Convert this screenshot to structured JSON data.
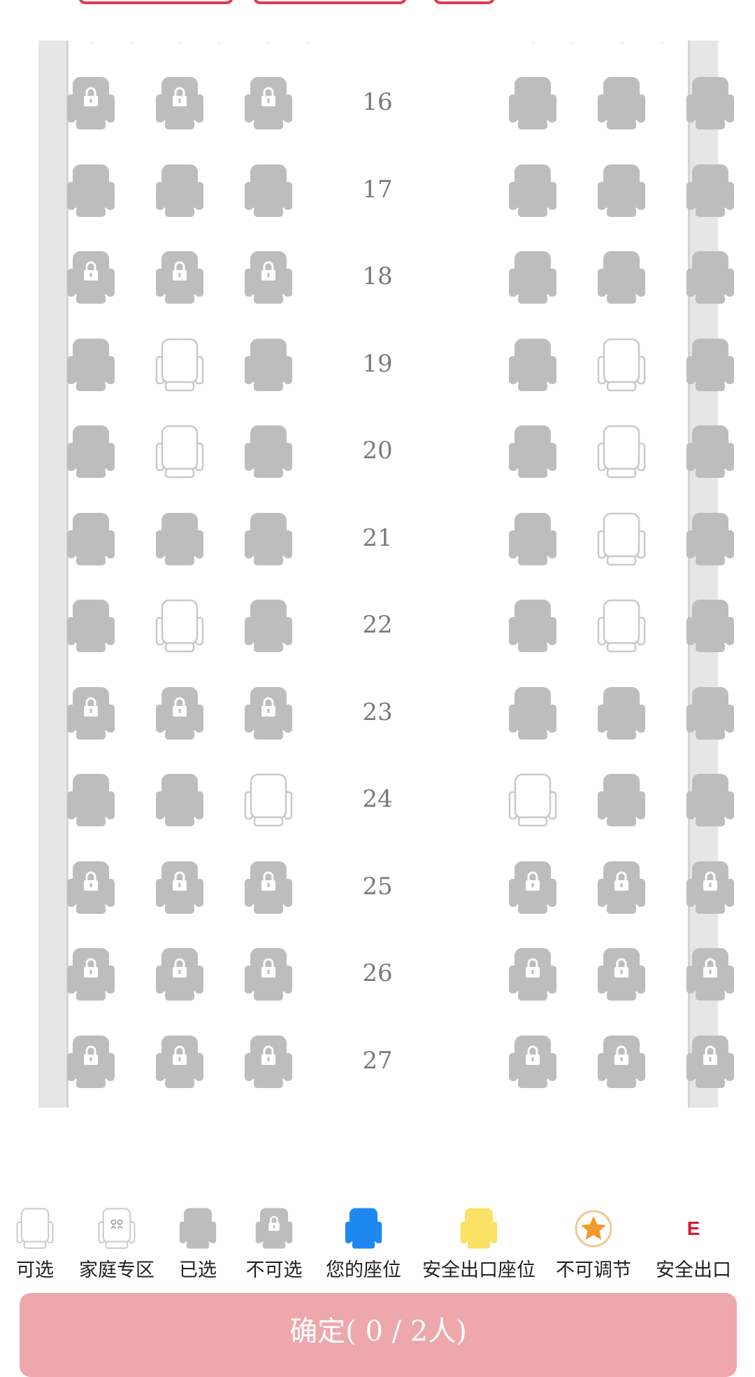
{
  "seat_map": {
    "rows": [
      {
        "number": "16",
        "seats": [
          "locked",
          "locked",
          "locked",
          "occupied",
          "occupied",
          "occupied"
        ]
      },
      {
        "number": "17",
        "seats": [
          "occupied",
          "occupied",
          "occupied",
          "occupied",
          "occupied",
          "occupied"
        ]
      },
      {
        "number": "18",
        "seats": [
          "locked",
          "locked",
          "locked",
          "occupied",
          "occupied",
          "occupied"
        ]
      },
      {
        "number": "19",
        "seats": [
          "occupied",
          "available",
          "occupied",
          "occupied",
          "available",
          "occupied"
        ]
      },
      {
        "number": "20",
        "seats": [
          "occupied",
          "available",
          "occupied",
          "occupied",
          "available",
          "occupied"
        ]
      },
      {
        "number": "21",
        "seats": [
          "occupied",
          "occupied",
          "occupied",
          "occupied",
          "available",
          "occupied"
        ]
      },
      {
        "number": "22",
        "seats": [
          "occupied",
          "available",
          "occupied",
          "occupied",
          "available",
          "occupied"
        ]
      },
      {
        "number": "23",
        "seats": [
          "locked",
          "locked",
          "locked",
          "occupied",
          "occupied",
          "occupied"
        ]
      },
      {
        "number": "24",
        "seats": [
          "occupied",
          "occupied",
          "available",
          "available",
          "occupied",
          "occupied"
        ]
      },
      {
        "number": "25",
        "seats": [
          "locked",
          "locked",
          "locked",
          "locked",
          "locked",
          "locked"
        ]
      },
      {
        "number": "26",
        "seats": [
          "locked",
          "locked",
          "locked",
          "locked",
          "locked",
          "locked"
        ]
      },
      {
        "number": "27",
        "seats": [
          "locked",
          "locked",
          "locked",
          "locked",
          "locked",
          "locked"
        ]
      }
    ]
  },
  "legend": [
    {
      "type": "available",
      "label": "可选"
    },
    {
      "type": "family",
      "label": "家庭专区"
    },
    {
      "type": "occupied",
      "label": "已选"
    },
    {
      "type": "locked",
      "label": "不可选"
    },
    {
      "type": "yours",
      "label": "您的座位"
    },
    {
      "type": "exit-row",
      "label": "安全出口座位"
    },
    {
      "type": "non-adjustable",
      "label": "不可调节"
    },
    {
      "type": "exit",
      "label": "安全出口",
      "mark": "E"
    }
  ],
  "confirm_button": {
    "label": "确定( 0 / 2人)"
  },
  "colors": {
    "occupied": "#bdbdbd",
    "available_outline": "#c9c9c9",
    "yours": "#1e88f0",
    "exit_row": "#fbe164",
    "star": "#f39a2b",
    "exit_mark": "#d9192f",
    "confirm_bg": "#eea7ab"
  }
}
